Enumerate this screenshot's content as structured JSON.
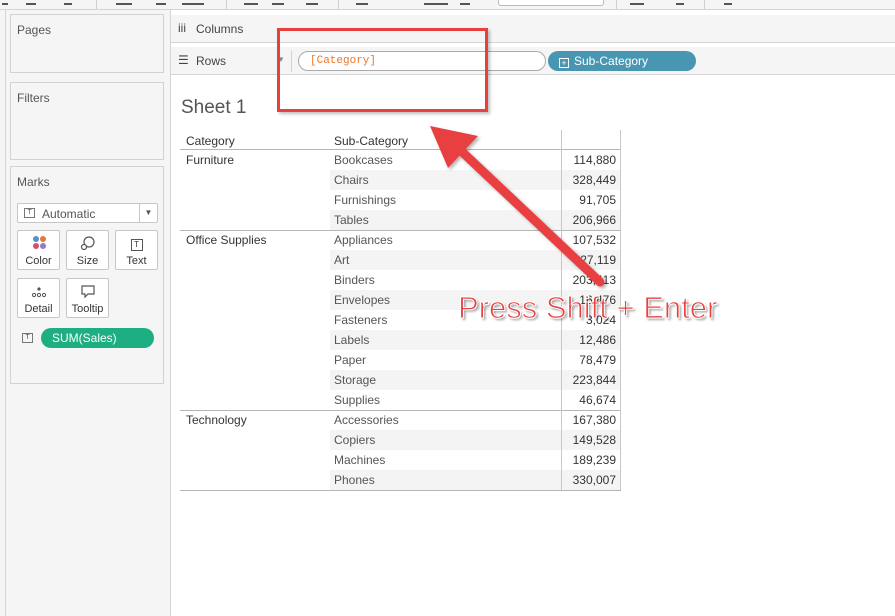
{
  "sidebar": {
    "pages_title": "Pages",
    "filters_title": "Filters",
    "marks": {
      "title": "Marks",
      "mark_type": "Automatic",
      "buttons": [
        {
          "label": "Color",
          "icon": "color-icon"
        },
        {
          "label": "Size",
          "icon": "size-icon"
        },
        {
          "label": "Text",
          "icon": "text-icon"
        },
        {
          "label": "Detail",
          "icon": "detail-icon"
        },
        {
          "label": "Tooltip",
          "icon": "tooltip-icon"
        }
      ],
      "field_pill": "SUM(Sales)"
    }
  },
  "shelves": {
    "columns_label": "Columns",
    "rows_label": "Rows",
    "rows_pill_editing": "[Category]",
    "rows_pill_2": "Sub-Category"
  },
  "sheet": {
    "title": "Sheet 1",
    "headers": {
      "category": "Category",
      "sub_category": "Sub-Category"
    },
    "groups": [
      {
        "category": "Furniture",
        "rows": [
          {
            "sub": "Bookcases",
            "value": "114,880"
          },
          {
            "sub": "Chairs",
            "value": "328,449"
          },
          {
            "sub": "Furnishings",
            "value": "91,705"
          },
          {
            "sub": "Tables",
            "value": "206,966"
          }
        ]
      },
      {
        "category": "Office Supplies",
        "rows": [
          {
            "sub": "Appliances",
            "value": "107,532"
          },
          {
            "sub": "Art",
            "value": "27,119"
          },
          {
            "sub": "Binders",
            "value": "203,413"
          },
          {
            "sub": "Envelopes",
            "value": "16,476"
          },
          {
            "sub": "Fasteners",
            "value": "3,024"
          },
          {
            "sub": "Labels",
            "value": "12,486"
          },
          {
            "sub": "Paper",
            "value": "78,479"
          },
          {
            "sub": "Storage",
            "value": "223,844"
          },
          {
            "sub": "Supplies",
            "value": "46,674"
          }
        ]
      },
      {
        "category": "Technology",
        "rows": [
          {
            "sub": "Accessories",
            "value": "167,380"
          },
          {
            "sub": "Copiers",
            "value": "149,528"
          },
          {
            "sub": "Machines",
            "value": "189,239"
          },
          {
            "sub": "Phones",
            "value": "330,007"
          }
        ]
      }
    ]
  },
  "annotation": {
    "text": "Press Shift + Enter",
    "color": "#e83f3f"
  },
  "colors": {
    "measure_pill": "#1dae82",
    "dimension_pill": "#4996b2",
    "editing_text": "#e8792b"
  }
}
